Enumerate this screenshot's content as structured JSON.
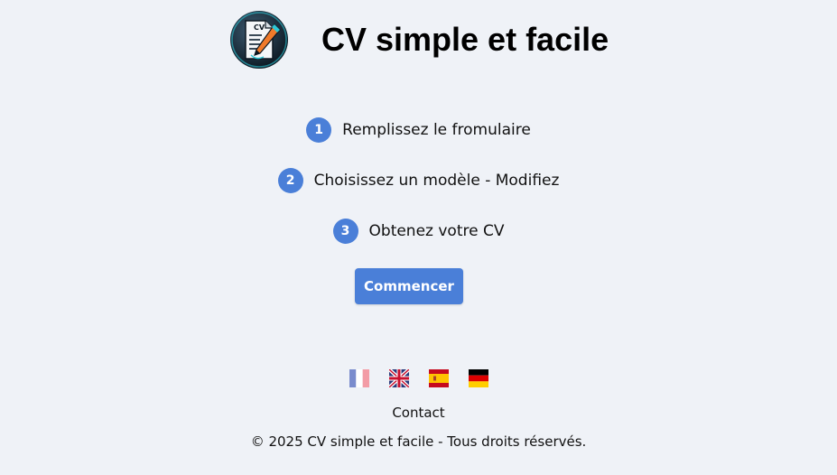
{
  "header": {
    "title": "CV simple et facile",
    "logo_icon": "cv-document-pen-icon",
    "logo_text": "CV"
  },
  "steps": [
    {
      "number": "1",
      "label": "Remplissez le fromulaire"
    },
    {
      "number": "2",
      "label": "Choisissez un modèle - Modifiez"
    },
    {
      "number": "3",
      "label": "Obtenez votre CV"
    }
  ],
  "start_button": {
    "label": "Commencer"
  },
  "languages": [
    {
      "name": "flag-fr-icon"
    },
    {
      "name": "flag-uk-icon"
    },
    {
      "name": "flag-es-icon"
    },
    {
      "name": "flag-de-icon"
    }
  ],
  "footer": {
    "contact": "Contact",
    "copyright": "© 2025 CV simple et facile - Tous droits réservés."
  },
  "colors": {
    "background": "#eff2f7",
    "accent": "#4a7fd8"
  }
}
